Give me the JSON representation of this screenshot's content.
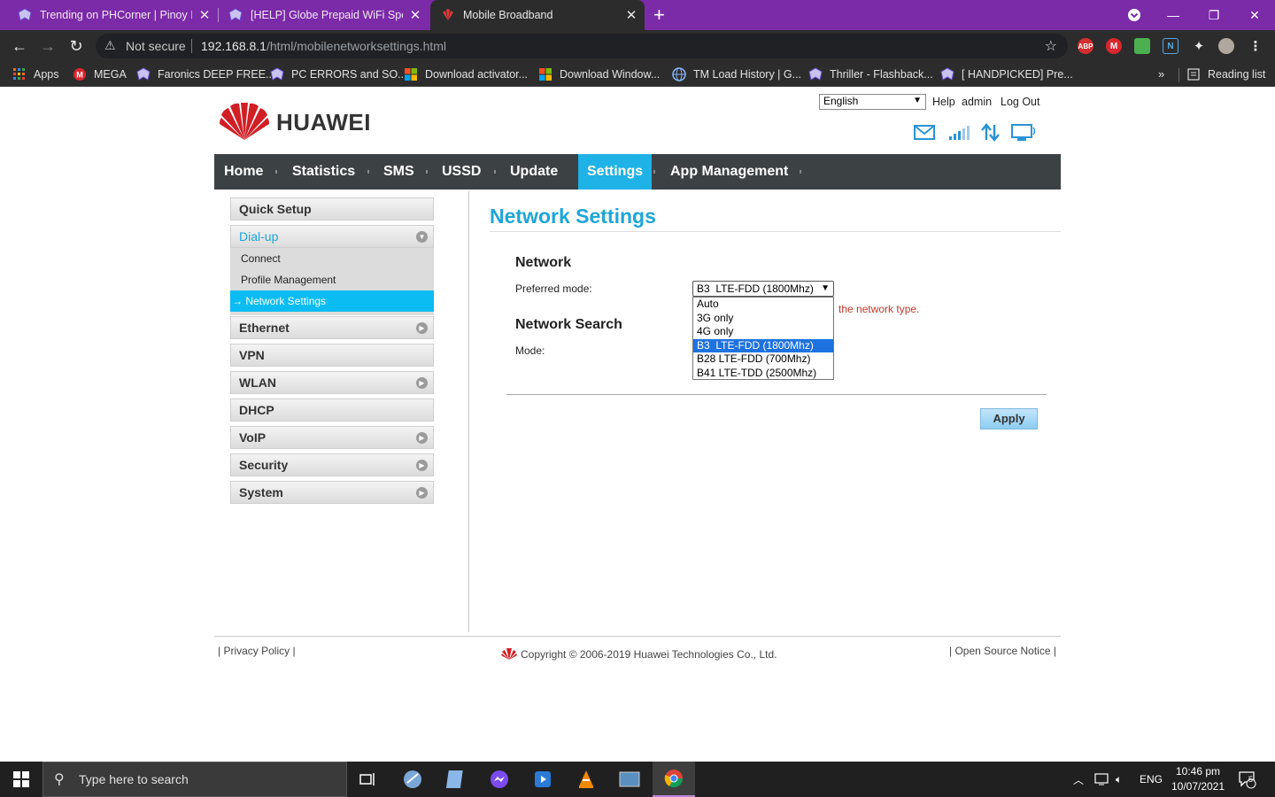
{
  "browser": {
    "tabs": [
      {
        "title": "Trending on PHCorner | Pinoy Int",
        "active": false
      },
      {
        "title": "[HELP] Globe Prepaid WiFi Speed",
        "active": false
      },
      {
        "title": "Mobile Broadband",
        "active": true
      }
    ],
    "new_tab": "+",
    "security_label": "Not secure",
    "url_host": "192.168.8.1",
    "url_path": "/html/mobilenetworksettings.html",
    "bookmarks": [
      "Apps",
      "MEGA",
      "Faronics DEEP FREE...",
      "PC ERRORS and SO...",
      "Download activator...",
      "Download Window...",
      "TM Load History | G...",
      "Thriller - Flashback...",
      "[ HANDPICKED] Pre..."
    ],
    "bookmarks_more": "»",
    "reading_list": "Reading list"
  },
  "header": {
    "logo_text": "HUAWEI",
    "language": "English",
    "links": {
      "help": "Help",
      "admin": "admin",
      "logout": "Log Out"
    }
  },
  "nav": [
    "Home",
    "Statistics",
    "SMS",
    "USSD",
    "Update",
    "Settings",
    "App Management"
  ],
  "nav_active": "Settings",
  "sidebar": {
    "items": [
      {
        "label": "Quick Setup",
        "arrow": false
      },
      {
        "label": "Dial-up",
        "arrow": true,
        "open": true,
        "children": [
          "Connect",
          "Profile Management",
          "→ Network Settings"
        ]
      },
      {
        "label": "Ethernet",
        "arrow": true
      },
      {
        "label": "VPN",
        "arrow": false
      },
      {
        "label": "WLAN",
        "arrow": true
      },
      {
        "label": "DHCP",
        "arrow": false
      },
      {
        "label": "VoIP",
        "arrow": true
      },
      {
        "label": "Security",
        "arrow": true
      },
      {
        "label": "System",
        "arrow": true
      }
    ],
    "active_child": "Network Settings"
  },
  "content": {
    "title": "Network Settings",
    "network_heading": "Network",
    "preferred_mode_label": "Preferred mode:",
    "preferred_mode_value": "B3  LTE-FDD (1800Mhz)",
    "preferred_mode_options": [
      "Auto",
      "3G only",
      "4G only",
      "B3  LTE-FDD (1800Mhz)",
      "B28 LTE-FDD (700Mhz)",
      "B41 LTE-TDD (2500Mhz)"
    ],
    "hint_text": "the network type.",
    "network_search_heading": "Network Search",
    "mode_label": "Mode:",
    "apply_label": "Apply"
  },
  "footer": {
    "privacy": "Privacy Policy",
    "copyright": "Copyright © 2006-2019 Huawei Technologies Co., Ltd.",
    "open_source": "Open Source Notice"
  },
  "taskbar": {
    "search_placeholder": "Type here to search",
    "language": "ENG",
    "time": "10:46 pm",
    "date": "10/07/2021",
    "notifications": "5"
  },
  "colors": {
    "tab_strip": "#7b2aa8",
    "chrome_dark": "#2c2c2c",
    "nav_bar": "#3c4144",
    "accent_blue": "#1fb2e6",
    "huawei_red": "#d11f26"
  }
}
